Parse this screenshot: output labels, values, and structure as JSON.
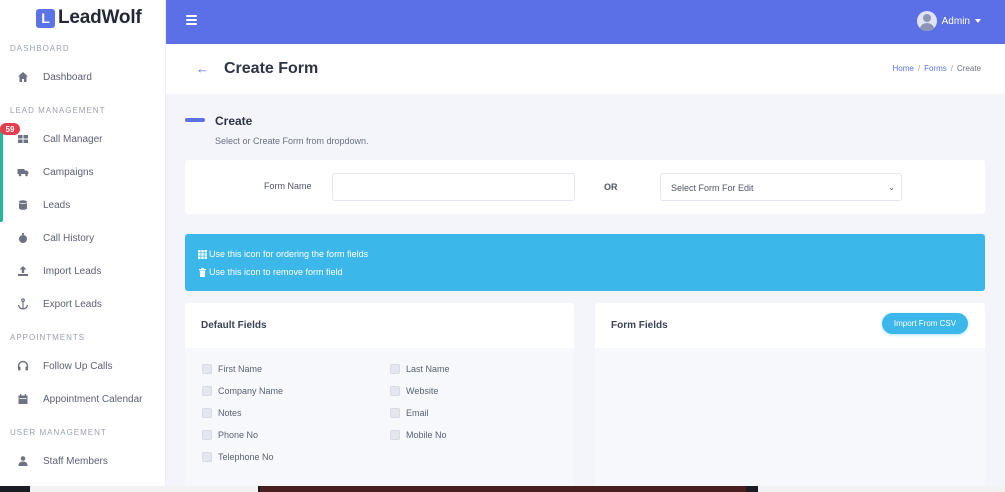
{
  "brand": {
    "mark": "L",
    "name": "LeadWolf"
  },
  "sidebar": {
    "sections": [
      {
        "title": "DASHBOARD",
        "items": [
          {
            "label": "Dashboard",
            "icon": "home-icon"
          }
        ]
      },
      {
        "title": "LEAD MANAGEMENT",
        "items": [
          {
            "label": "Call Manager",
            "icon": "grid-icon"
          },
          {
            "label": "Campaigns",
            "icon": "truck-icon"
          },
          {
            "label": "Leads",
            "icon": "database-icon"
          },
          {
            "label": "Call History",
            "icon": "stopwatch-icon"
          },
          {
            "label": "Import Leads",
            "icon": "upload-icon"
          },
          {
            "label": "Export Leads",
            "icon": "anchor-icon"
          }
        ]
      },
      {
        "title": "APPOINTMENTS",
        "items": [
          {
            "label": "Follow Up Calls",
            "icon": "headphones-icon"
          },
          {
            "label": "Appointment Calendar",
            "icon": "calendar-icon"
          }
        ]
      },
      {
        "title": "USER MANAGEMENT",
        "items": [
          {
            "label": "Staff Members",
            "icon": "user-icon"
          }
        ]
      }
    ],
    "badge": "59"
  },
  "header": {
    "user_name": "Admin"
  },
  "page": {
    "title": "Create Form",
    "breadcrumb": {
      "home": "Home",
      "forms": "Forms",
      "current": "Create",
      "separator": "/"
    }
  },
  "create": {
    "title": "Create",
    "subtitle": "Select or Create Form from dropdown."
  },
  "form": {
    "name_label": "Form Name",
    "name_value": "",
    "or_label": "OR",
    "select_value": "Select Form For Edit"
  },
  "info": {
    "line1": "Use this icon for ordering the form fields",
    "line2": "Use this icon to remove form field"
  },
  "default_fields": {
    "title": "Default Fields",
    "items": [
      "First Name",
      "Last Name",
      "Company Name",
      "Website",
      "Notes",
      "Email",
      "Phone No",
      "Mobile No",
      "Telephone No"
    ]
  },
  "form_fields": {
    "title": "Form Fields",
    "import_label": "Import From CSV"
  }
}
